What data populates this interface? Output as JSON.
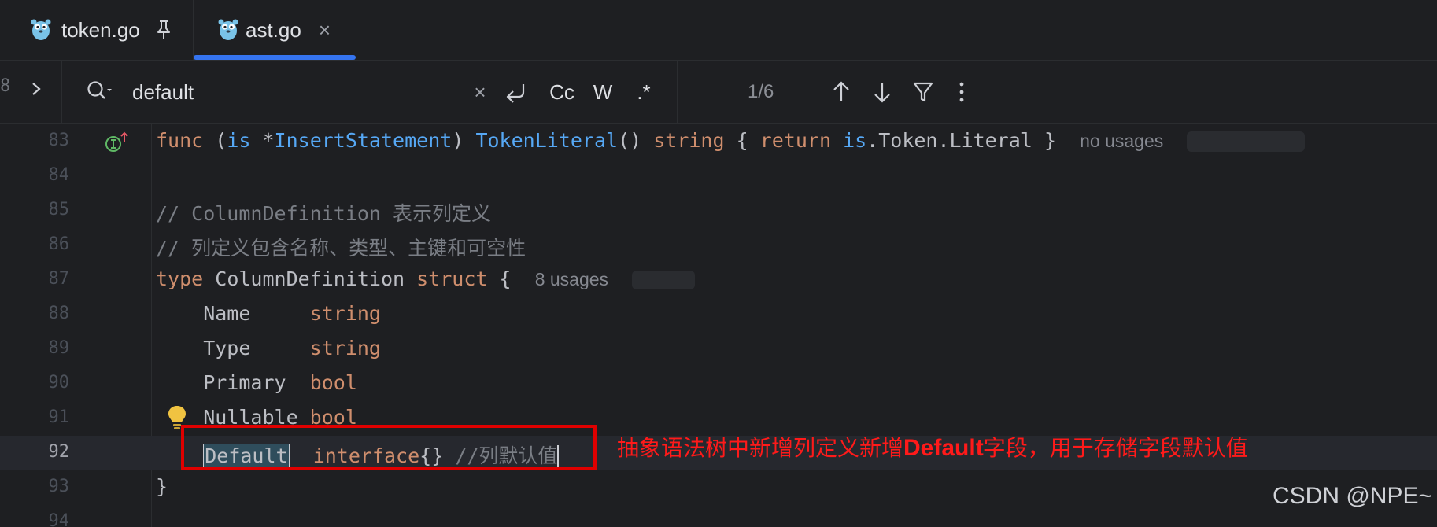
{
  "tabs": [
    {
      "label": "token.go",
      "icon": "go-gopher-icon",
      "pinned": true
    },
    {
      "label": "ast.go",
      "icon": "go-gopher-icon",
      "active": true,
      "close": "×"
    }
  ],
  "find": {
    "gutter_digit": "8",
    "query": "default",
    "clear": "×",
    "match_case": "Cc",
    "whole_words": "W",
    "regex": ".*",
    "count": "1/6"
  },
  "editor": {
    "lines": [
      {
        "num": "83"
      },
      {
        "num": "84"
      },
      {
        "num": "85"
      },
      {
        "num": "86"
      },
      {
        "num": "87"
      },
      {
        "num": "88"
      },
      {
        "num": "89"
      },
      {
        "num": "90"
      },
      {
        "num": "91"
      },
      {
        "num": "92"
      },
      {
        "num": "93"
      },
      {
        "num": "94"
      }
    ],
    "l83": {
      "func": "func",
      "open": " (",
      "recv": "is",
      "star": " *",
      "type": "InsertStatement",
      "close": ") ",
      "method": "TokenLiteral",
      "parens": "() ",
      "ret": "string",
      "brace": " { ",
      "return": "return",
      "sp": " ",
      "body": "is",
      "rest": ".Token.Literal }",
      "hint": "no usages"
    },
    "l85": {
      "comment": "// ColumnDefinition 表示列定义"
    },
    "l86": {
      "comment": "// 列定义包含名称、类型、主键和可空性"
    },
    "l87": {
      "type": "type",
      "name": " ColumnDefinition ",
      "struct": "struct",
      "brace": " {",
      "hint": "8 usages"
    },
    "fields": [
      {
        "name": "    Name     ",
        "type": "string"
      },
      {
        "name": "    Type     ",
        "type": "string"
      },
      {
        "name": "    Primary  ",
        "type": "bool"
      },
      {
        "name": "    Nullable ",
        "type": "bool"
      }
    ],
    "l92": {
      "indent": "    ",
      "match": "Default",
      "gap": "  ",
      "type": "interface",
      "rest": "{} ",
      "comment": "//列默认值"
    },
    "l93": {
      "brace": "}"
    }
  },
  "annotation": {
    "pre": "抽象语法树中新增列定义新增",
    "bold": "Default",
    "post": "字段，用于存储字段默认值"
  },
  "watermark": "CSDN @NPE~",
  "colors": {
    "background": "#1e1f22",
    "accent": "#3574f0",
    "keyword": "#cf8e6d",
    "type": "#56a8f5",
    "annotation": "#ff1a1a"
  }
}
